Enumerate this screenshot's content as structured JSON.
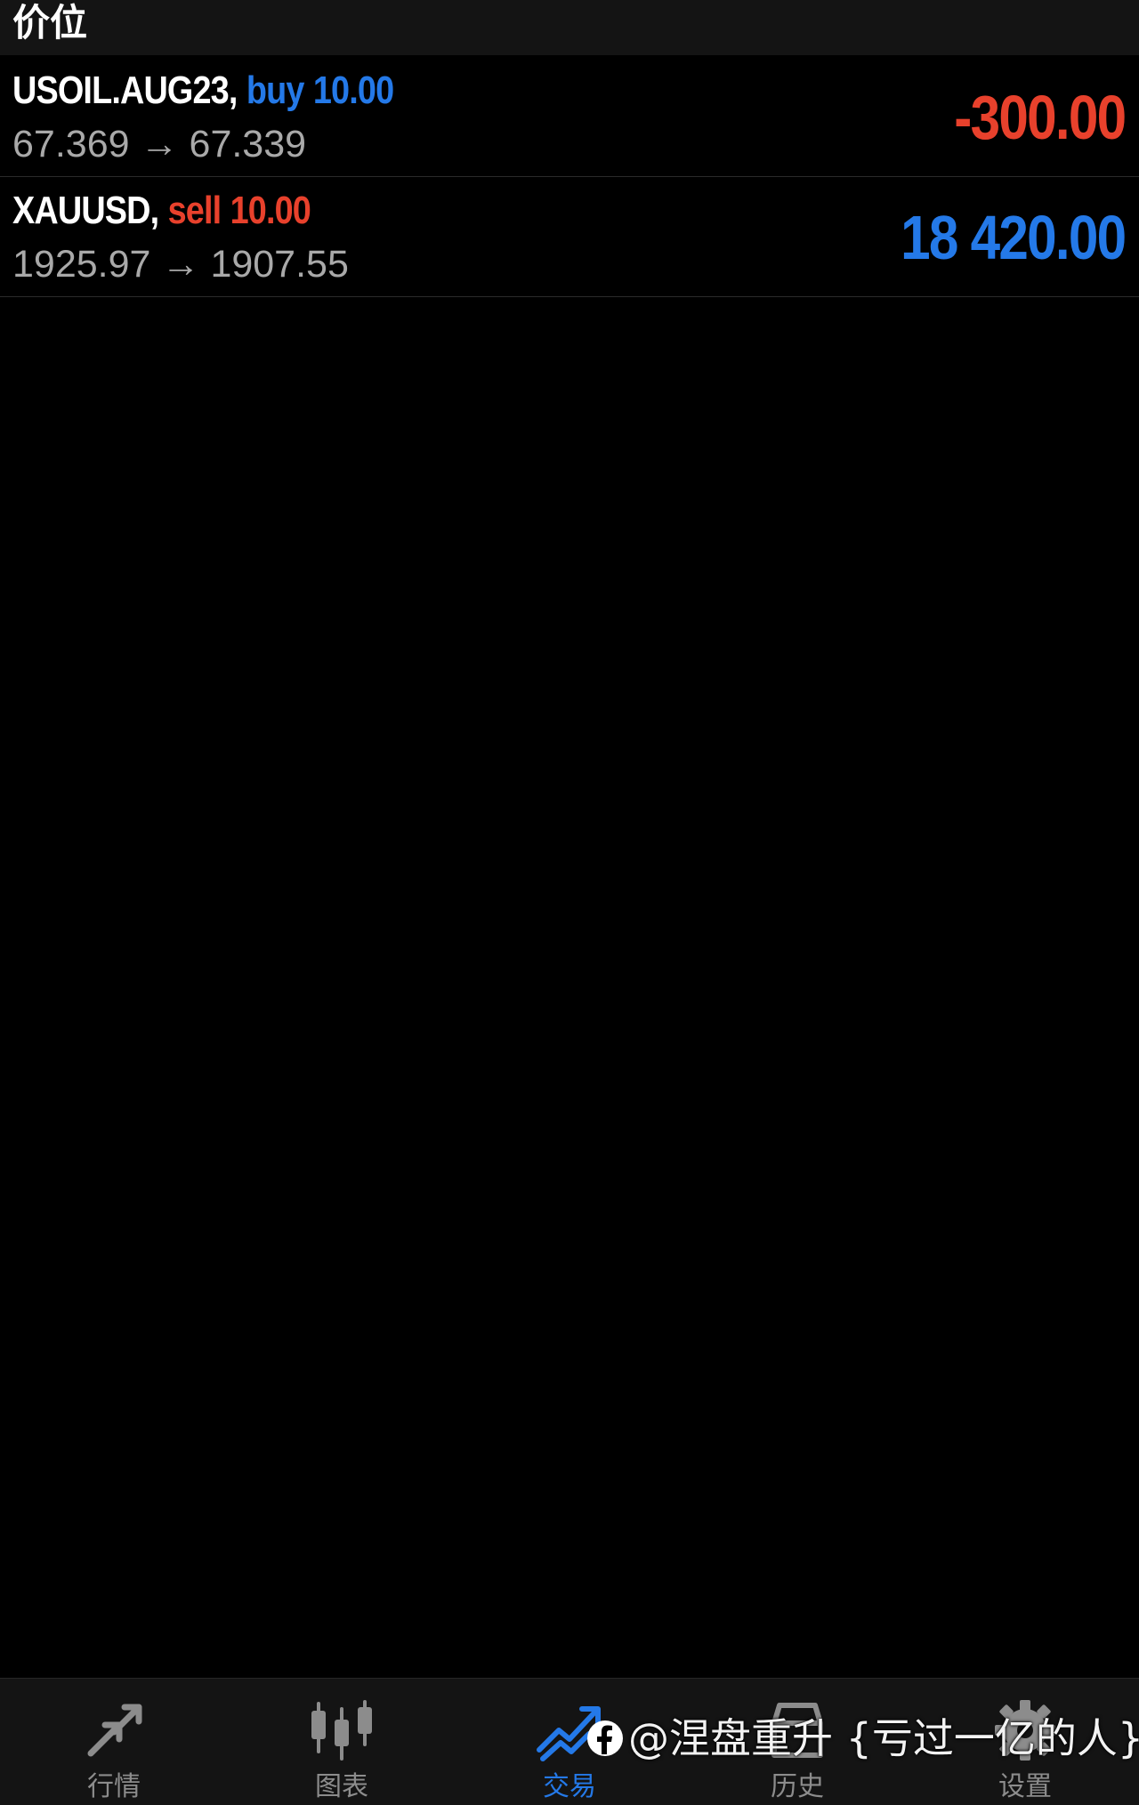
{
  "header": {
    "title": "价位"
  },
  "positions": [
    {
      "symbol": "USOIL.AUG23,",
      "side": "buy",
      "volume": "10.00",
      "open_price": "67.369",
      "arrow": "→",
      "current_price": "67.339",
      "profit": "-300.00",
      "side_color": "#2479e8",
      "profit_color": "#e8412c"
    },
    {
      "symbol": "XAUUSD,",
      "side": "sell",
      "volume": "10.00",
      "open_price": "1925.97",
      "arrow": "→",
      "current_price": "1907.55",
      "profit": "18 420.00",
      "side_color": "#e8412c",
      "profit_color": "#2479e8"
    }
  ],
  "tabbar": {
    "tabs": [
      {
        "label": "行情",
        "icon": "quotes-icon",
        "active": false
      },
      {
        "label": "图表",
        "icon": "chart-candles-icon",
        "active": false
      },
      {
        "label": "交易",
        "icon": "trade-icon",
        "active": true
      },
      {
        "label": "历史",
        "icon": "history-icon",
        "active": false
      },
      {
        "label": "设置",
        "icon": "settings-icon",
        "active": false
      }
    ],
    "active_color": "#2479e8",
    "inactive_color": "#8c8c8c"
  },
  "watermark": {
    "text": "@涅盘重升 {亏过一亿的人}",
    "icon": "facebook-icon"
  }
}
